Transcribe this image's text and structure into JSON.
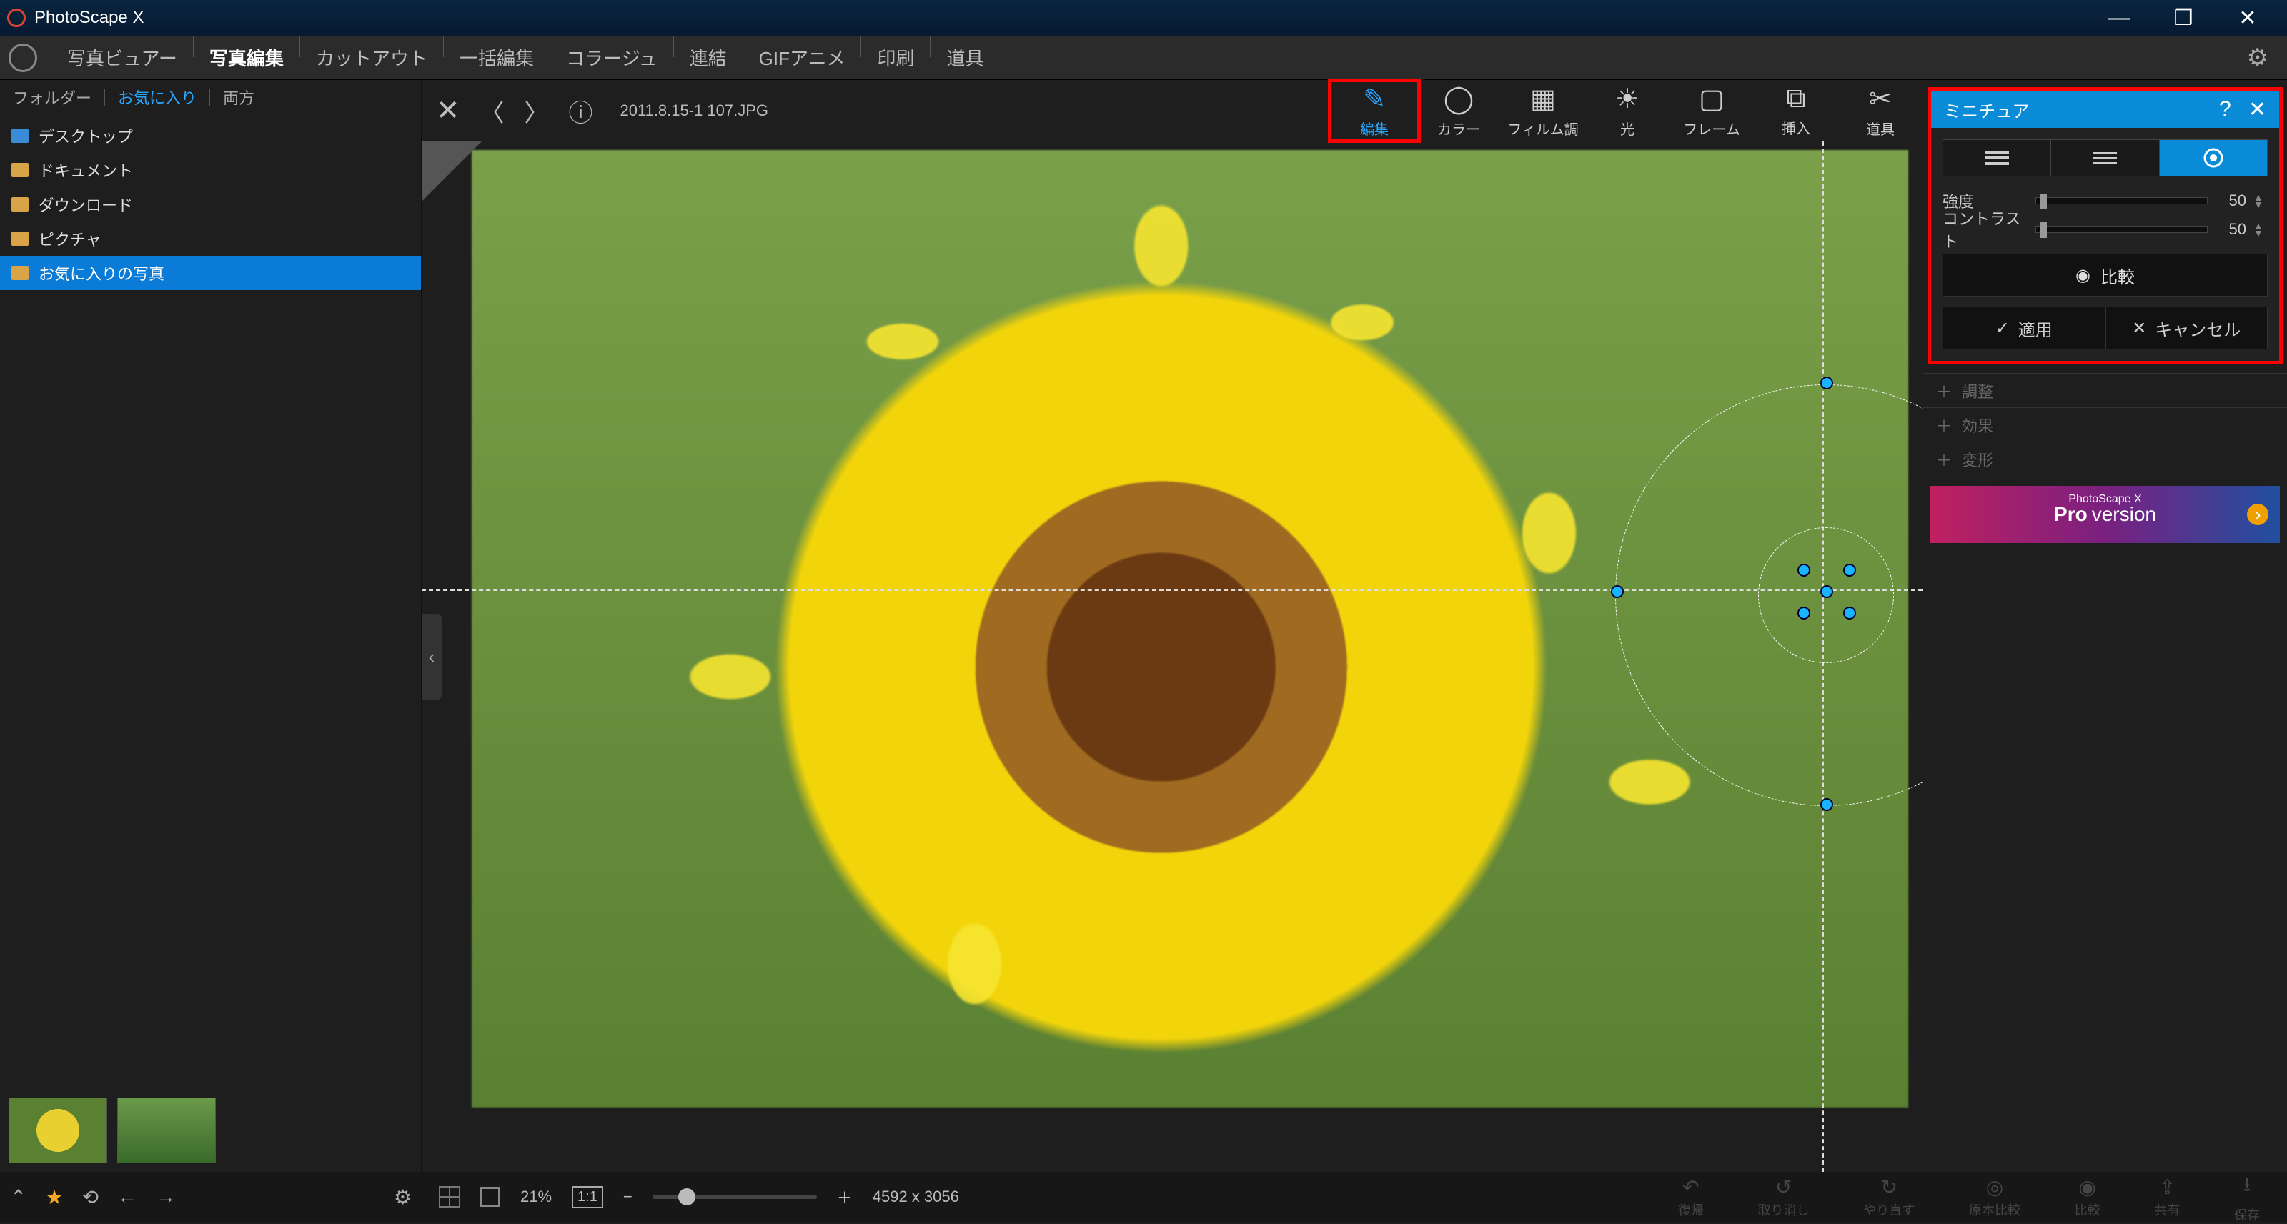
{
  "app": {
    "title": "PhotoScape X",
    "pro_badge": "PRO\nVersion"
  },
  "window_buttons": {
    "min": "—",
    "max": "❐",
    "close": "✕"
  },
  "main_tabs": [
    "写真ビュアー",
    "写真編集",
    "カットアウト",
    "一括編集",
    "コラージュ",
    "連結",
    "GIFアニメ",
    "印刷",
    "道具"
  ],
  "main_tabs_active": 1,
  "sidebar": {
    "tabs": [
      "フォルダー",
      "お気に入り",
      "両方"
    ],
    "active": 1,
    "tree": [
      {
        "label": "デスクトップ",
        "color": "blue"
      },
      {
        "label": "ドキュメント"
      },
      {
        "label": "ダウンロード"
      },
      {
        "label": "ピクチャ"
      },
      {
        "label": "お気に入りの写真",
        "selected": true
      }
    ]
  },
  "canvas": {
    "filename": "2011.8.15-1 107.JPG",
    "tools": [
      {
        "label": "編集",
        "icon": "✎",
        "active": true,
        "highlight": true
      },
      {
        "label": "カラー",
        "icon": "◯"
      },
      {
        "label": "フィルム調",
        "icon": "▦"
      },
      {
        "label": "光",
        "icon": "☀"
      },
      {
        "label": "フレーム",
        "icon": "▢"
      },
      {
        "label": "挿入",
        "icon": "⧉"
      },
      {
        "label": "道具",
        "icon": "✂"
      }
    ]
  },
  "panel": {
    "title": "ミニチュア",
    "modes_active": 2,
    "sliders": [
      {
        "name": "強度",
        "value": "50"
      },
      {
        "name": "コントラスト",
        "value": "50"
      }
    ],
    "compare": "比較",
    "apply": "適用",
    "cancel": "キャンセル",
    "accordion": [
      "調整",
      "効果",
      "変形"
    ]
  },
  "promo": {
    "small": "PhotoScape X",
    "big": "Pro version"
  },
  "statusbar": {
    "zoom": "21%",
    "fit": "1:1",
    "dims": "4592 x 3056",
    "right": [
      {
        "label": "復帰",
        "icon": "↶"
      },
      {
        "label": "取り消し",
        "icon": "↺"
      },
      {
        "label": "やり直す",
        "icon": "↻"
      },
      {
        "label": "原本比較",
        "icon": "◎"
      },
      {
        "label": "比較",
        "icon": "◉"
      },
      {
        "label": "共有",
        "icon": "⇪"
      },
      {
        "label": "保存",
        "icon": "⭳"
      }
    ]
  }
}
